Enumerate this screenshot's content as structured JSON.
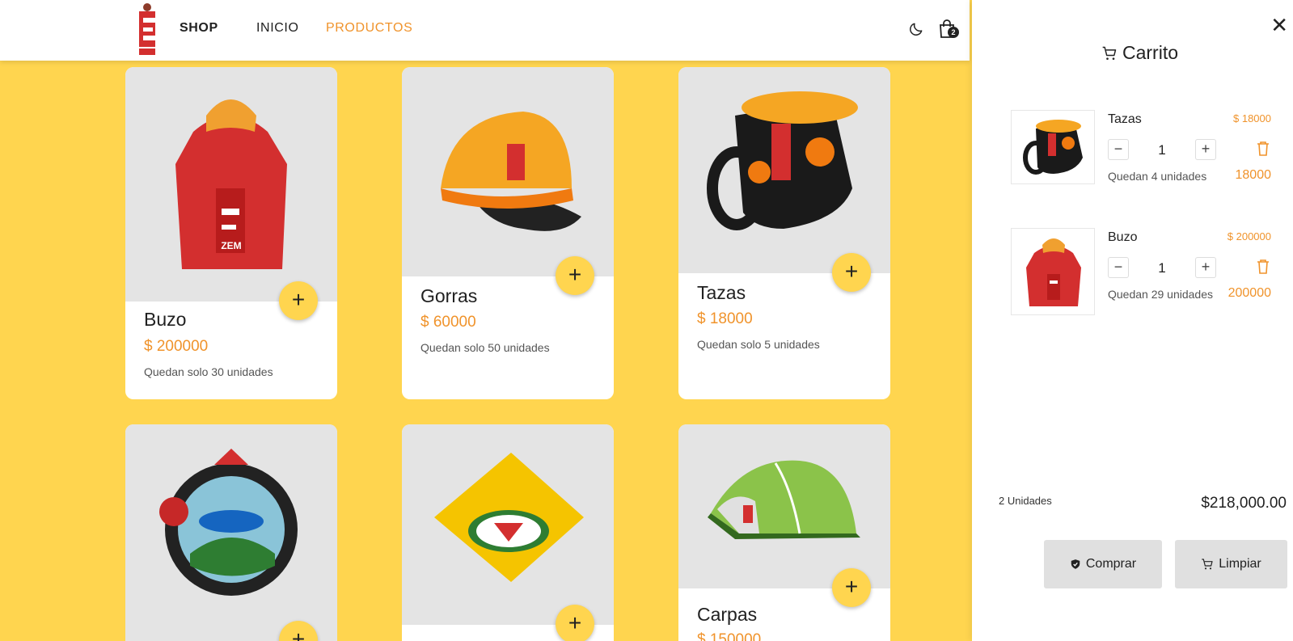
{
  "header": {
    "brand": "SHOP",
    "nav": [
      "INICIO",
      "PRODUCTOS"
    ],
    "cart_count": "2"
  },
  "products": [
    {
      "name": "Buzo",
      "price": "$ 200000",
      "stock": "Quedan solo 30 unidades"
    },
    {
      "name": "Gorras",
      "price": "$ 60000",
      "stock": "Quedan solo 50 unidades"
    },
    {
      "name": "Tazas",
      "price": "$ 18000",
      "stock": "Quedan solo 5 unidades"
    },
    {
      "name": "",
      "price": "",
      "stock": ""
    },
    {
      "name": "",
      "price": "",
      "stock": ""
    },
    {
      "name": "Carpas",
      "price": "$ 150000",
      "stock": ""
    }
  ],
  "cart": {
    "title": "Carrito",
    "items": [
      {
        "name": "Tazas",
        "unit_price": "$ 18000",
        "qty": "1",
        "stock": "Quedan 4 unidades",
        "total": "18000"
      },
      {
        "name": "Buzo",
        "unit_price": "$ 200000",
        "qty": "1",
        "stock": "Quedan 29 unidades",
        "total": "200000"
      }
    ],
    "units_label": "2 Unidades",
    "sum": "$218,000.00",
    "buy_label": "Comprar",
    "clear_label": "Limpiar"
  },
  "colors": {
    "accent": "#f0932b",
    "background": "#ffd54f"
  }
}
